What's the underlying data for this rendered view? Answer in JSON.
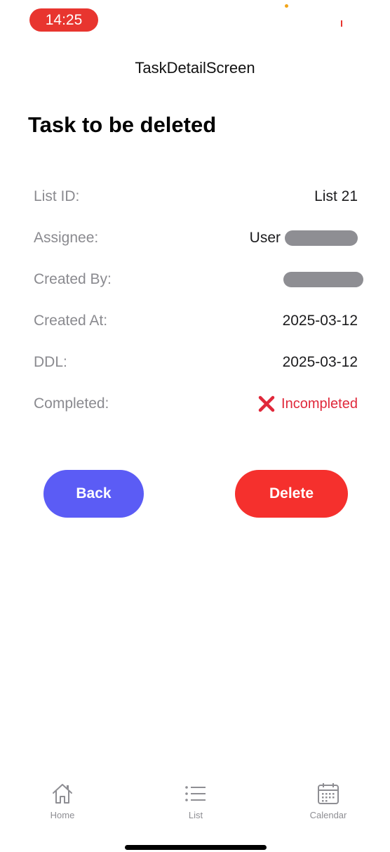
{
  "status_bar": {
    "time": "14:25"
  },
  "header": {
    "title": "TaskDetailScreen"
  },
  "task": {
    "title": "Task to be deleted",
    "fields": {
      "list_id": {
        "label": "List ID:",
        "value": "List 21"
      },
      "assignee": {
        "label": "Assignee:",
        "value": "User"
      },
      "created_by": {
        "label": "Created By:"
      },
      "created_at": {
        "label": "Created At:",
        "value": "2025-03-12"
      },
      "ddl": {
        "label": "DDL:",
        "value": "2025-03-12"
      },
      "completed": {
        "label": "Completed:",
        "value": "Incompleted",
        "icon": "x-mark-icon"
      }
    }
  },
  "actions": {
    "back_label": "Back",
    "delete_label": "Delete"
  },
  "tab_bar": {
    "items": [
      {
        "label": "Home",
        "icon": "home-icon"
      },
      {
        "label": "List",
        "icon": "list-icon"
      },
      {
        "label": "Calendar",
        "icon": "calendar-icon"
      }
    ]
  },
  "colors": {
    "accent_back": "#5b5cf5",
    "accent_delete": "#f5302d",
    "status_incomplete": "#e0283a",
    "time_pill": "#e8352f"
  }
}
